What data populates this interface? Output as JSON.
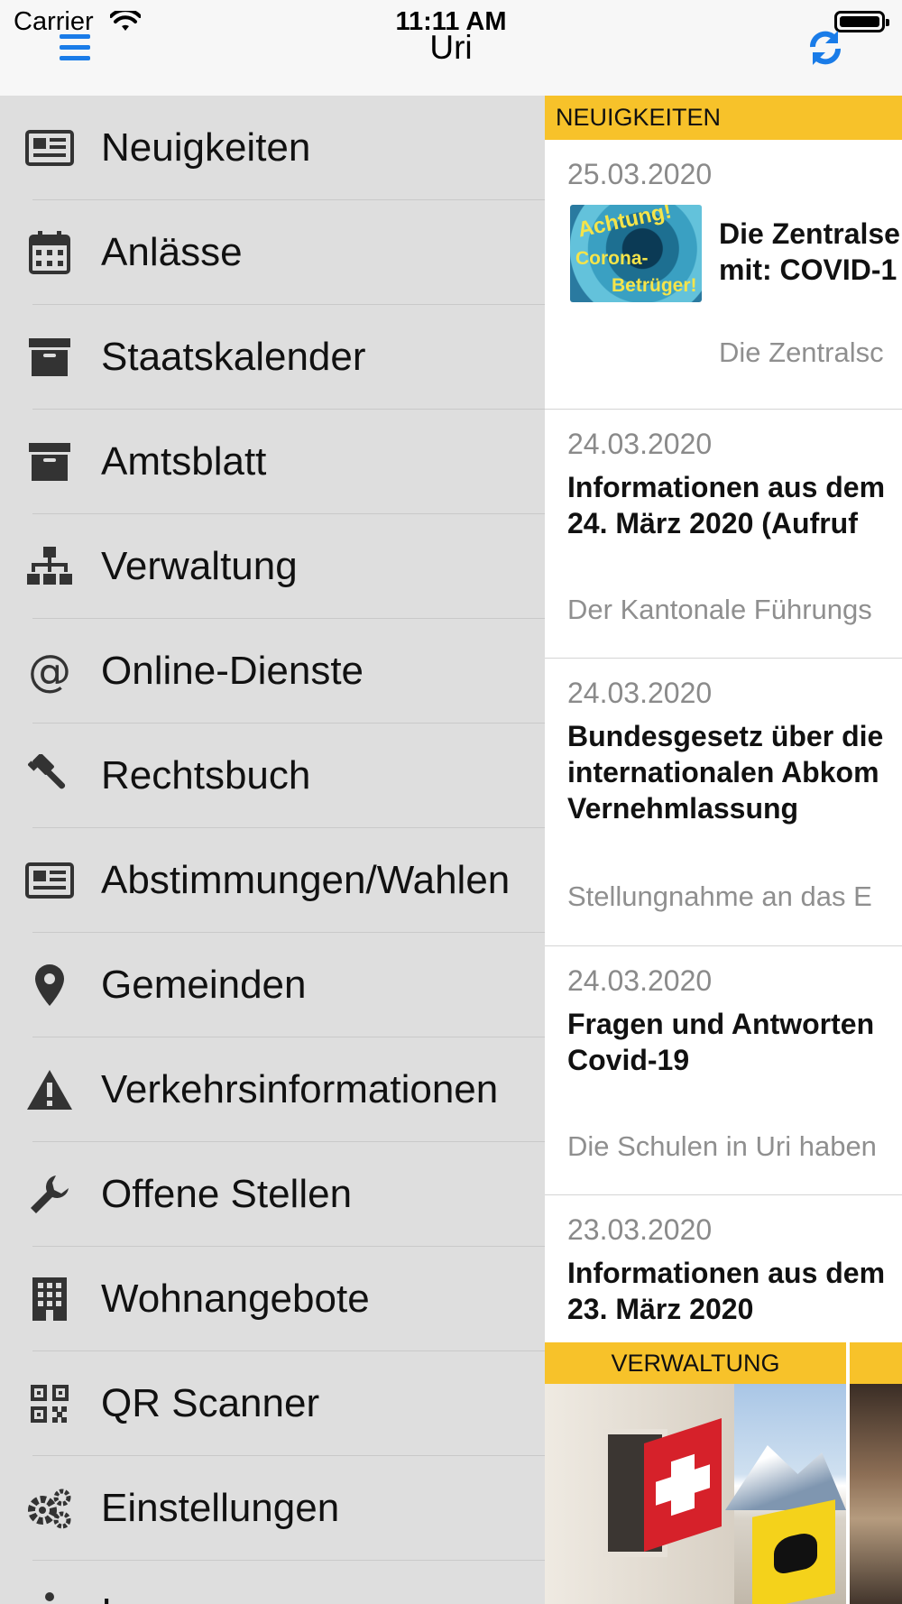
{
  "status_bar": {
    "carrier": "Carrier",
    "time": "11:11 AM"
  },
  "nav": {
    "title": "Uri"
  },
  "colors": {
    "accent": "#1a7ce8",
    "section": "#f7c22a",
    "menu_bg": "#dedede"
  },
  "menu": {
    "items": [
      {
        "label": "Neuigkeiten",
        "icon": "newspaper-icon"
      },
      {
        "label": "Anlässe",
        "icon": "calendar-icon"
      },
      {
        "label": "Staatskalender",
        "icon": "archive-box-icon"
      },
      {
        "label": "Amtsblatt",
        "icon": "archive-box-icon"
      },
      {
        "label": "Verwaltung",
        "icon": "sitemap-icon"
      },
      {
        "label": "Online-Dienste",
        "icon": "at-sign-icon"
      },
      {
        "label": "Rechtsbuch",
        "icon": "gavel-icon"
      },
      {
        "label": "Abstimmungen/Wahlen",
        "icon": "newspaper-icon"
      },
      {
        "label": "Gemeinden",
        "icon": "map-pin-icon"
      },
      {
        "label": "Verkehrsinformationen",
        "icon": "warning-icon"
      },
      {
        "label": "Offene Stellen",
        "icon": "wrench-icon"
      },
      {
        "label": "Wohnangebote",
        "icon": "building-icon"
      },
      {
        "label": "QR Scanner",
        "icon": "qr-code-icon"
      },
      {
        "label": "Einstellungen",
        "icon": "gears-icon"
      },
      {
        "label": "Impressum",
        "icon": "info-icon"
      }
    ]
  },
  "news": {
    "section_label": "NEUIGKEITEN",
    "items": [
      {
        "date": "25.03.2020",
        "headline": [
          "Die Zentralse",
          "mit: COVID-1"
        ],
        "teaser": "Die Zentralsc",
        "thumb_text": [
          "Achtung!",
          "Corona-",
          "Betrüger!"
        ]
      },
      {
        "date": "24.03.2020",
        "headline": [
          "Informationen aus dem",
          "24. März 2020 (Aufruf"
        ],
        "teaser": "Der Kantonale Führungs"
      },
      {
        "date": "24.03.2020",
        "headline": [
          "Bundesgesetz über die",
          "internationalen Abkom",
          "Vernehmlassung"
        ],
        "teaser": "Stellungnahme an das E"
      },
      {
        "date": "24.03.2020",
        "headline": [
          "Fragen und Antworten",
          "Covid-19"
        ],
        "teaser": "Die Schulen in Uri haben"
      },
      {
        "date": "23.03.2020",
        "headline": [
          "Informationen aus dem",
          "23. März 2020"
        ]
      }
    ]
  },
  "bottom": {
    "section_label": "VERWALTUNG"
  }
}
